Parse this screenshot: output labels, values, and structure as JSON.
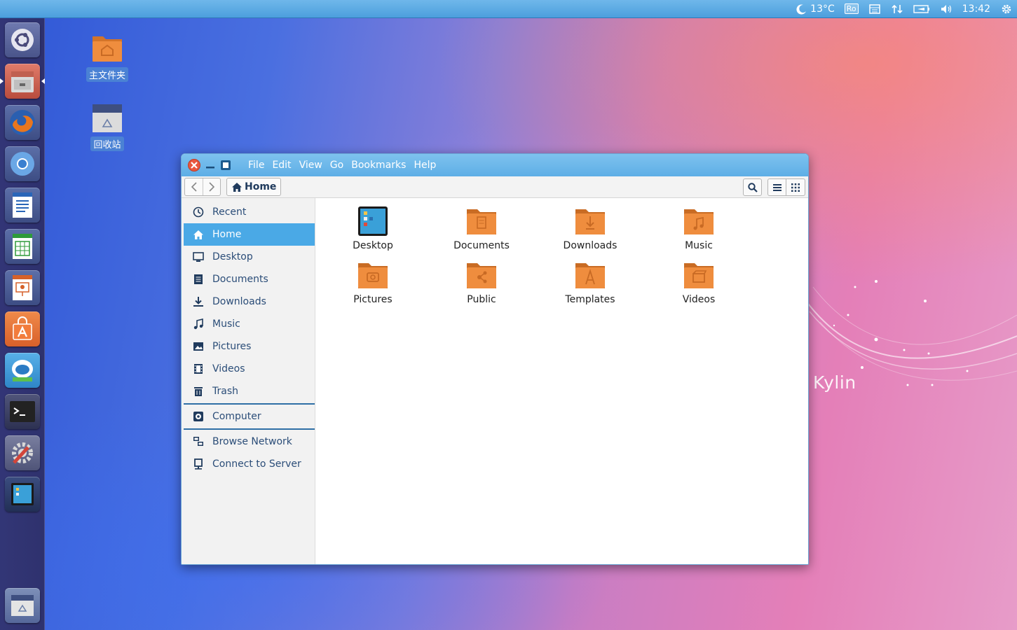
{
  "topbar": {
    "weather": "13°C",
    "keyboard": "Ro",
    "clock": "13:42",
    "icons": [
      "moon-icon",
      "calendar-icon",
      "network-icon",
      "battery-icon",
      "volume-icon",
      "gear-icon"
    ]
  },
  "launcher": {
    "items": [
      "ubuntu-kylin-home",
      "files",
      "firefox",
      "chromium",
      "libreoffice-writer",
      "libreoffice-calc",
      "libreoffice-impress",
      "software-center",
      "kylin-assistant",
      "terminal",
      "system-settings",
      "desktop-viewer",
      "trash"
    ]
  },
  "desktop": {
    "home_folder_label": "主文件夹",
    "trash_label": "回收站",
    "wallpaper_brand": "Kylin"
  },
  "window": {
    "menu": [
      "File",
      "Edit",
      "View",
      "Go",
      "Bookmarks",
      "Help"
    ],
    "path": "Home",
    "sidebar": [
      {
        "label": "Recent",
        "icon": "clock-icon"
      },
      {
        "label": "Home",
        "icon": "home-icon",
        "active": true
      },
      {
        "label": "Desktop",
        "icon": "monitor-icon"
      },
      {
        "label": "Documents",
        "icon": "document-icon"
      },
      {
        "label": "Downloads",
        "icon": "download-icon"
      },
      {
        "label": "Music",
        "icon": "music-icon"
      },
      {
        "label": "Pictures",
        "icon": "picture-icon"
      },
      {
        "label": "Videos",
        "icon": "film-icon"
      },
      {
        "label": "Trash",
        "icon": "trash-icon"
      }
    ],
    "devices": [
      {
        "label": "Computer",
        "icon": "computer-icon"
      }
    ],
    "network": [
      {
        "label": "Browse Network",
        "icon": "network-icon"
      },
      {
        "label": "Connect to Server",
        "icon": "server-icon"
      }
    ],
    "files": [
      {
        "label": "Desktop",
        "kind": "desktop"
      },
      {
        "label": "Documents",
        "kind": "folder"
      },
      {
        "label": "Downloads",
        "kind": "folder"
      },
      {
        "label": "Music",
        "kind": "folder"
      },
      {
        "label": "Pictures",
        "kind": "folder"
      },
      {
        "label": "Public",
        "kind": "folder"
      },
      {
        "label": "Templates",
        "kind": "folder"
      },
      {
        "label": "Videos",
        "kind": "folder"
      }
    ]
  },
  "colors": {
    "panel": "#5aa8e2",
    "accent": "#4aa9e6",
    "folder": "#e8873a",
    "close": "#e9573e"
  }
}
